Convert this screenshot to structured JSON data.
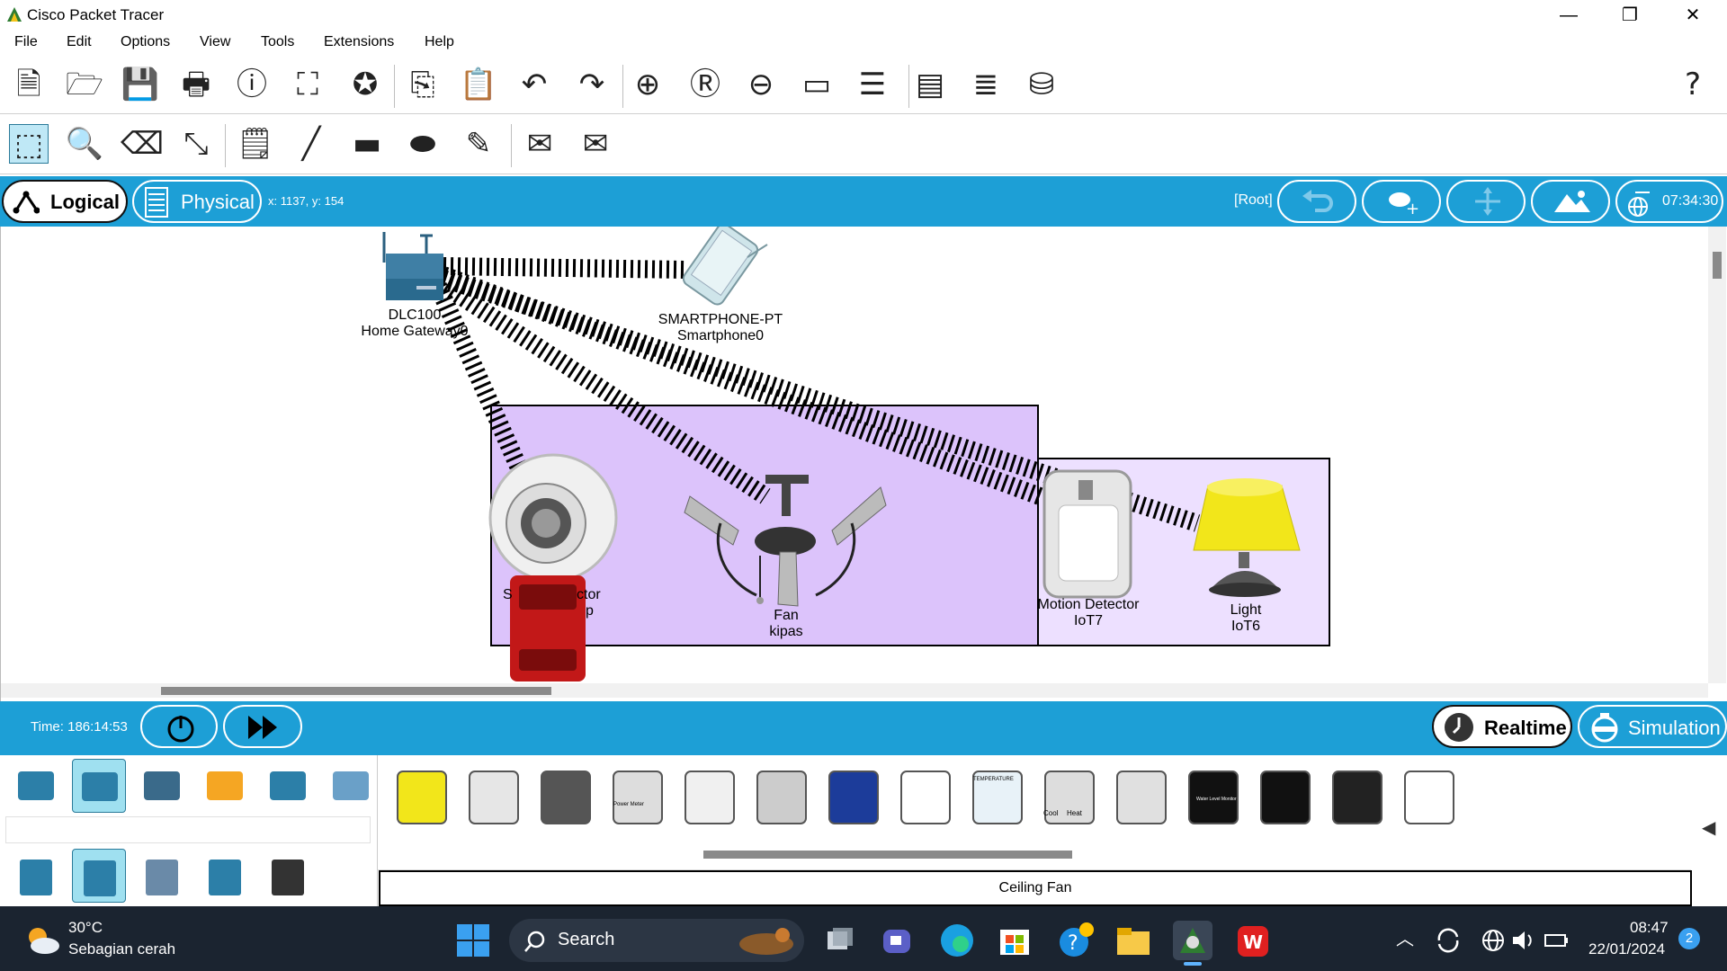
{
  "window": {
    "title": "Cisco Packet Tracer",
    "controls": [
      "—",
      "❐",
      "✕"
    ]
  },
  "menu": [
    "File",
    "Edit",
    "Options",
    "View",
    "Tools",
    "Extensions",
    "Help"
  ],
  "toolbar_main_icons": [
    "new-file-icon",
    "open-folder-icon",
    "save-icon",
    "print-icon",
    "info-icon",
    "activity-wizard-icon",
    "ipc-icon",
    "copy-icon",
    "paste-icon",
    "undo-icon",
    "redo-icon",
    "zoom-in-icon",
    "zoom-reset-icon",
    "zoom-out-icon",
    "drawing-palette-icon",
    "custom-devices-icon",
    "pdu-list-icon",
    "device-template-icon",
    "network-info-icon",
    "help-icon"
  ],
  "toolbar_main_glyphs": [
    "🗎",
    "🗁",
    "💾",
    "🖶",
    "ⓘ",
    "⛶",
    "✪",
    "⎘",
    "📋",
    "↶",
    "↷",
    "⊕",
    "Ⓡ",
    "⊖",
    "▭",
    "☰",
    "▤",
    "≣",
    "⛁",
    "?"
  ],
  "toolbar_tools_icons": [
    "select-icon",
    "inspect-icon",
    "delete-icon",
    "resize-icon",
    "note-icon",
    "line-icon",
    "rectangle-icon",
    "ellipse-icon",
    "freeform-icon",
    "simple-pdu-icon",
    "complex-pdu-icon"
  ],
  "toolbar_tools_glyphs": [
    "⬚",
    "🔍",
    "⌫",
    "⤡",
    "🗒",
    "╱",
    "▬",
    "⬬",
    "✎",
    "✉",
    "✉"
  ],
  "bluebar": {
    "logical_label": "Logical",
    "physical_label": "Physical",
    "coords": "x: 1137, y: 154",
    "root_label": "[Root]",
    "clock": "07:34:30"
  },
  "devices": [
    {
      "name": "home-gateway",
      "line1": "DLC100",
      "line2": "Home Gateway0"
    },
    {
      "name": "smartphone",
      "line1": "SMARTPHONE-PT",
      "line2": "Smartphone0"
    },
    {
      "name": "smoke-detector",
      "line1": "S",
      "line2": "ctor",
      "line3": "p"
    },
    {
      "name": "fan",
      "line1": "Fan",
      "line2": "kipas"
    },
    {
      "name": "motion-detector",
      "line1": "Motion Detector",
      "line2": "IoT7"
    },
    {
      "name": "light",
      "line1": "Light",
      "line2": "IoT6"
    }
  ],
  "bottombar": {
    "time": "Time: 186:14:53",
    "realtime_label": "Realtime",
    "simulation_label": "Simulation"
  },
  "palette": {
    "categories_top": [
      "network-devices",
      "end-devices",
      "components",
      "connections",
      "miscellaneous",
      "multiuser"
    ],
    "categories_bottom": [
      "end-devices-sub",
      "home-sub",
      "smart-city-sub",
      "industrial-sub",
      "power-grid-sub"
    ],
    "device_icons": [
      "light",
      "door-sensor",
      "smartphone",
      "power-meter",
      "air-cleaner",
      "speaker",
      "solar-panel",
      "lcd",
      "thermostat",
      "hvac",
      "ceiling-fan",
      "water-level-monitor",
      "webcam",
      "wind-detector",
      "window"
    ],
    "selected_device_name": "Ceiling Fan",
    "hvac_labels": [
      "Cool",
      "Heat"
    ],
    "thermostat_label": "TEMPERATURE",
    "water_monitor_label": "Water Level Monitor",
    "power_meter_label": "Power Meter"
  },
  "taskbar": {
    "temperature": "30°C",
    "weather": "Sebagian cerah",
    "search_placeholder": "Search",
    "time": "08:47",
    "date": "22/01/2024",
    "notification_count": "2"
  },
  "colors": {
    "accent_blue": "#1d9fd6",
    "cluster_purple": "#dcc3fb",
    "cluster_light": "#ede0ff",
    "taskbar": "#1b2430"
  }
}
